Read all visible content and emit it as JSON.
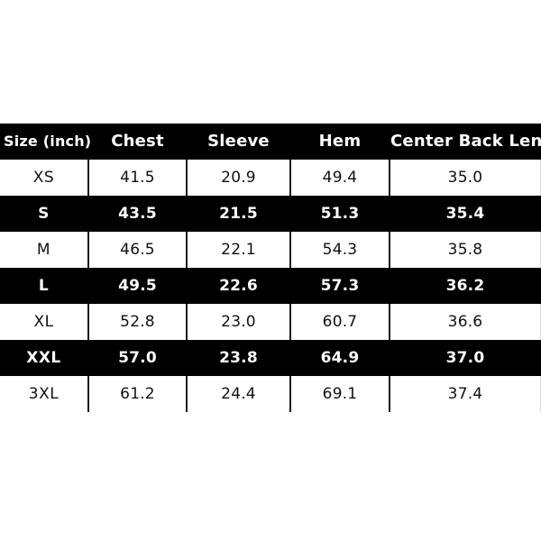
{
  "chart_data": {
    "type": "table",
    "title": "Size (inch)",
    "columns": [
      "Size  (inch)",
      "Chest",
      "Sleeve",
      "Hem",
      "Center Back Length"
    ],
    "categories": [
      "XS",
      "S",
      "M",
      "L",
      "XL",
      "XXL",
      "3XL"
    ],
    "series": [
      {
        "name": "Chest",
        "values": [
          41.5,
          43.5,
          46.5,
          49.5,
          52.8,
          57.0,
          61.2
        ]
      },
      {
        "name": "Sleeve",
        "values": [
          20.9,
          21.5,
          22.1,
          22.6,
          23.0,
          23.8,
          24.4
        ]
      },
      {
        "name": "Hem",
        "values": [
          49.4,
          51.3,
          54.3,
          57.3,
          60.7,
          64.9,
          69.1
        ]
      },
      {
        "name": "Center Back Length",
        "values": [
          35.0,
          35.4,
          35.8,
          36.2,
          36.6,
          37.0,
          37.4
        ]
      }
    ],
    "unit": "inch",
    "legend": "none",
    "grid": true
  },
  "colors": {
    "page_background": "#ffffff",
    "header_background": "#000000",
    "header_text": "#ffffff",
    "dark_row_background": "#000000",
    "dark_row_text": "#ffffff",
    "light_row_background": "#ffffff",
    "light_row_text": "#111111",
    "divider": "#1a1a1a"
  },
  "table": {
    "header": {
      "size": "Size  (inch)",
      "chest": "Chest",
      "sleeve": "Sleeve",
      "hem": "Hem",
      "center_back_length": "Center Back Length"
    },
    "rows": [
      {
        "size": "XS",
        "chest": "41.5",
        "sleeve": "20.9",
        "hem": "49.4",
        "cbl": "35.0",
        "style": "light"
      },
      {
        "size": "S",
        "chest": "43.5",
        "sleeve": "21.5",
        "hem": "51.3",
        "cbl": "35.4",
        "style": "dark"
      },
      {
        "size": "M",
        "chest": "46.5",
        "sleeve": "22.1",
        "hem": "54.3",
        "cbl": "35.8",
        "style": "light"
      },
      {
        "size": "L",
        "chest": "49.5",
        "sleeve": "22.6",
        "hem": "57.3",
        "cbl": "36.2",
        "style": "dark"
      },
      {
        "size": "XL",
        "chest": "52.8",
        "sleeve": "23.0",
        "hem": "60.7",
        "cbl": "36.6",
        "style": "light"
      },
      {
        "size": "XXL",
        "chest": "57.0",
        "sleeve": "23.8",
        "hem": "64.9",
        "cbl": "37.0",
        "style": "dark"
      },
      {
        "size": "3XL",
        "chest": "61.2",
        "sleeve": "24.4",
        "hem": "69.1",
        "cbl": "37.4",
        "style": "light"
      }
    ]
  }
}
